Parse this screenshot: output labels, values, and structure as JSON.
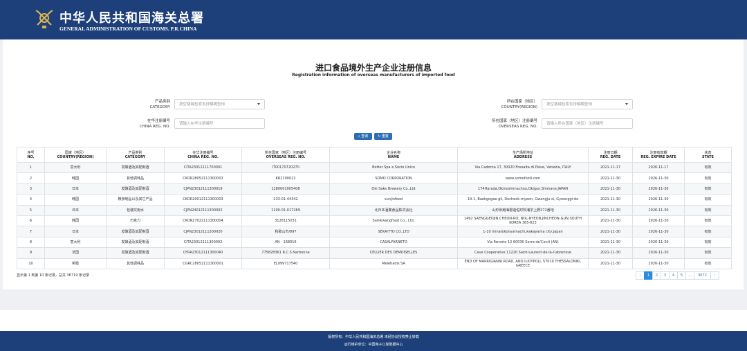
{
  "header": {
    "title_cn": "中华人民共和国海关总署",
    "title_en": "GENERAL ADMINISTRATION OF CUSTOMS. P.R.CHINA"
  },
  "page": {
    "title_cn": "进口食品境外生产企业注册信息",
    "title_en": "Registration information of overseas manufacturers of imported food"
  },
  "filters": {
    "category_label_cn": "产品类别",
    "category_label_en": "CATEGORY",
    "category_placeholder": "按空格键检索支持模糊查询",
    "country_label_cn": "所在国家（地区）",
    "country_label_en": "COUNTRY(REGION)",
    "country_placeholder": "按空格键检索支持模糊查询",
    "china_reg_label_cn": "在华注册编号",
    "china_reg_label_en": "CHINA REG. NO.",
    "china_reg_placeholder": "请输入在华注册编号",
    "overseas_reg_label_cn": "所在国家（地区）注册编号",
    "overseas_reg_label_en": "OVERSEAS REG. NO.",
    "overseas_reg_placeholder": "请输入所在国家（地区）注册编号",
    "search_label": "查询",
    "reset_label": "重置"
  },
  "table": {
    "headers": [
      {
        "cn": "序号",
        "en": "NO."
      },
      {
        "cn": "国家（地区）",
        "en": "COUNTRY(REGION)"
      },
      {
        "cn": "产品类别",
        "en": "CATEGORY"
      },
      {
        "cn": "在华注册编号",
        "en": "CHINA REG. NO."
      },
      {
        "cn": "所在国家（地区）注册编号",
        "en": "OVERSEAS REG. NO."
      },
      {
        "cn": "企业名称",
        "en": "NAME"
      },
      {
        "cn": "生产场所地址",
        "en": "ADDRESS"
      },
      {
        "cn": "注册日期",
        "en": "REG. DATE"
      },
      {
        "cn": "注册有效期",
        "en": "REG. EXPIRE DATE"
      },
      {
        "cn": "状态",
        "en": "STATE"
      }
    ],
    "rows": [
      [
        "1",
        "意大利",
        "发酵酒及其配制酒",
        "CITA23012111700001",
        "IT00170720270",
        "Botter Spa e Socio Unico",
        "Via Cadorna 17, 30020 Fossalta di Piave, Venezia, ITALY",
        "2021-11-17",
        "2026-11-17",
        "有效"
      ],
      [
        "2",
        "韩国",
        "其他调味品",
        "CKOR28052111300002",
        "KR2100022",
        "SOMO CORPORATION",
        "www.somofood.com",
        "2021-11-30",
        "2026-11-30",
        "有效"
      ],
      [
        "3",
        "日本",
        "发酵酒及其配制酒",
        "CJPN23012111300019",
        "1280001005408",
        "Oki Sake Brewery Co.,Ltd",
        "174Harada,Okinoshimachou,Okigun,Shimane,JAPAN",
        "2021-11-30",
        "2026-11-30",
        "有效"
      ],
      [
        "4",
        "韩国",
        "粮食制品以及其它产品",
        "CKOR20012111300003",
        "233-01-44342",
        "sunjinfood",
        "19-1, Baekgogae-gil, Docheok-myeon, Gwangju-si, Gyeonggi-do",
        "2021-11-30",
        "2026-11-30",
        "有效"
      ],
      [
        "5",
        "日本",
        "包装饮用水",
        "CJPN24012111300002",
        "1100-01-017269",
        "北日本酒業食品株式会社",
        "山形県飽海郡遊佐町吹浦字上野272番地",
        "2021-11-30",
        "2026-11-30",
        "有效"
      ],
      [
        "6",
        "韩国",
        "巧克力",
        "CKOR27022111300004",
        "3128115031",
        "Samkwangfood Co., Ltd.",
        "1492 SAENGGEOJIN CHEON-RO, NOL-NYEON,JINCHEON-GUN,SOUTH KOREA 365-823",
        "2021-11-30",
        "2026-11-30",
        "有效"
      ],
      [
        "7",
        "日本",
        "发酵酒及其配制酒",
        "CJPN23012111300020",
        "和歌山市/897",
        "SEKAITTO CO.,LTD",
        "1-10 minatokonyamachi,wakayama city,Japan",
        "2021-11-30",
        "2026-11-30",
        "有效"
      ],
      [
        "8",
        "意大利",
        "发酵酒及其配制酒",
        "CITA23012111300002",
        "AN - 168016",
        "CASALFARNETO",
        "Via Farneto 12 60030 Serra de'Conti (AN)",
        "2021-11-30",
        "2026-11-30",
        "有效"
      ],
      [
        "9",
        "法国",
        "发酵酒及其配制酒",
        "CFRA23012111300040",
        "775828361 R.C.S.Narbonne",
        "CELLIER DES DEMOISELLES",
        "Cave Cooperative 11220 Saint-Laurent-de-la-Cabrerisse",
        "2021-11-30",
        "2026-11-30",
        "有效"
      ],
      [
        "10",
        "希腊",
        "其他调味品",
        "CGRC28052111300001",
        "EL999717540",
        "Meletiadis SA",
        "END OF MAKRIGIANNI ROAD, ANO ILIOYPOLI, 57010 THESSALONIKI, GREECE",
        "2021-11-30",
        "2026-11-30",
        "有效"
      ]
    ]
  },
  "chart_data": {
    "type": "table",
    "columns": [
      "序号 NO.",
      "国家（地区） COUNTRY(REGION)",
      "产品类别 CATEGORY",
      "在华注册编号 CHINA REG. NO.",
      "所在国家（地区）注册编号 OVERSEAS REG. NO.",
      "企业名称 NAME",
      "生产场所地址 ADDRESS",
      "注册日期 REG. DATE",
      "注册有效期 REG. EXPIRE DATE",
      "状态 STATE"
    ],
    "row_count": 10,
    "total_records": 36719
  },
  "pagination": {
    "summary": "显示第 1 到第 10 条记录，总共 36719 条记录",
    "prev": "‹",
    "pages": [
      "1",
      "2",
      "3",
      "4",
      "5",
      "...",
      "3672"
    ],
    "next": "›",
    "active_page": "1"
  },
  "footer": {
    "line1": "版权所有：中华人民共和国海关总署 未经协议授权禁止转载",
    "line2": "运行维护单位：中国电子口岸数据中心"
  },
  "colors": {
    "brand_blue": "#1d3f7a",
    "button_blue": "#2d6db5",
    "active_page": "#2d8be0"
  }
}
